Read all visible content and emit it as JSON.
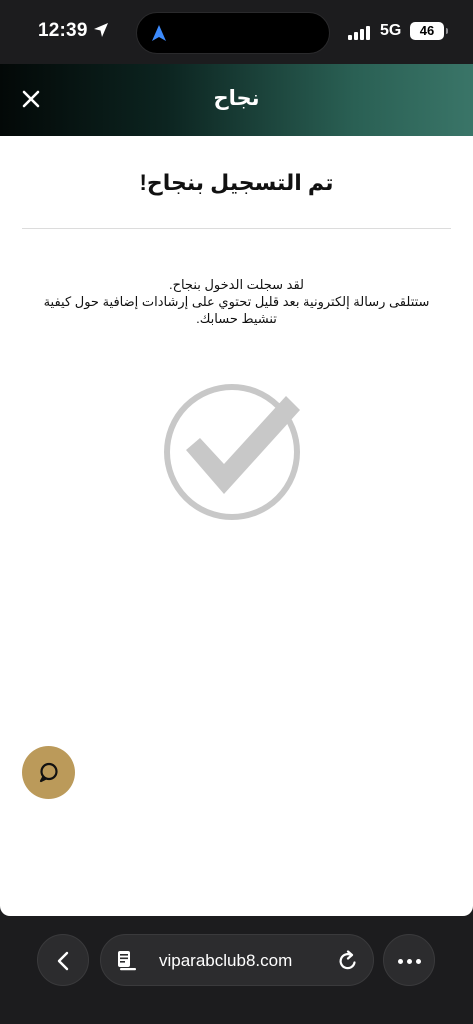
{
  "status_bar": {
    "time": "12:39",
    "network": "5G",
    "battery": "46",
    "icons": [
      "location-arrow-icon",
      "navigation-icon",
      "signal-icon",
      "battery-icon"
    ]
  },
  "modal": {
    "title": "نجاح",
    "close_icon": "close-icon",
    "heading": "تم التسجيل بنجاح!",
    "message_line1": "لقد سجلت الدخول بنجاح.",
    "message_line2": "ستتلقى رسالة إلكترونية بعد قليل تحتوي على إرشادات إضافية حول كيفية",
    "message_line3": "تنشيط حسابك.",
    "success_icon": "checkmark-circle-icon",
    "chat_icon": "chat-bubble-icon"
  },
  "browser": {
    "url": "viparabclub8.com",
    "back_icon": "chevron-left-icon",
    "reader_icon": "page-settings-icon",
    "reload_icon": "reload-icon",
    "more_icon": "more-icon"
  },
  "colors": {
    "header_gradient_start": "#030807",
    "header_gradient_end": "#3a7568",
    "chat_button": "#bb9a5a",
    "checkmark": "#c8c8c8",
    "browser_bg": "#1c1c1e"
  }
}
